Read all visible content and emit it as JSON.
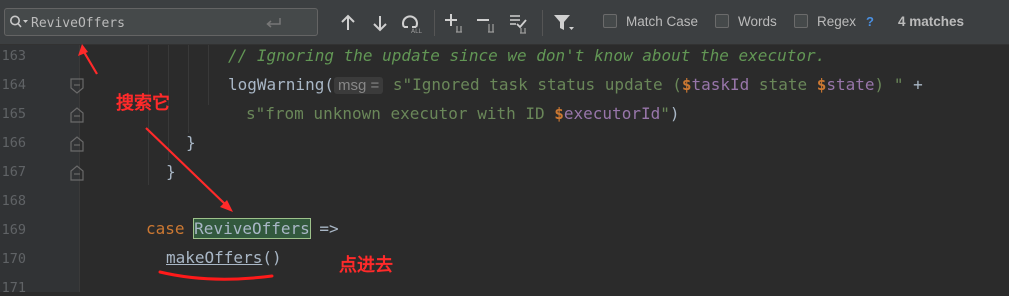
{
  "toolbar": {
    "search_value": "ReviveOffers",
    "match_case_label": "Match Case",
    "words_label": "Words",
    "regex_label": "Regex",
    "help_label": "?",
    "matches_label": "4 matches"
  },
  "gutter": {
    "line_numbers": [
      "163",
      "164",
      "165",
      "166",
      "167",
      "168",
      "169",
      "170",
      "171"
    ]
  },
  "code": {
    "l163_comment": "// Ignoring the update since we don't know about the executor.",
    "l164_fn": "logWarning(",
    "l164_hint": "msg =",
    "l164_s": "s\"Ignored task status update (",
    "l164_d1": "$",
    "l164_v1": "taskId",
    "l164_mid": " state ",
    "l164_d2": "$",
    "l164_v2": "state",
    "l164_close": ") \"",
    "l164_plus": " +",
    "l165_s": "s\"from unknown executor with ID ",
    "l165_d": "$",
    "l165_v": "executorId",
    "l165_close": "\"",
    "l165_paren": ")",
    "l166": "}",
    "l167": "}",
    "l169_kw": "case",
    "l169_match": "ReviveOffers",
    "l169_arrow": "=>",
    "l170_call": "makeOffers",
    "l170_parens": "()"
  },
  "annotations": {
    "search_note": "搜索它",
    "click_note": "点进去"
  },
  "colors": {
    "background": "#2b2b2b",
    "comment": "#629755",
    "keyword": "#cc7832",
    "string": "#6a8759",
    "match_highlight": "#32593d",
    "annotation": "#ff2a2a"
  }
}
